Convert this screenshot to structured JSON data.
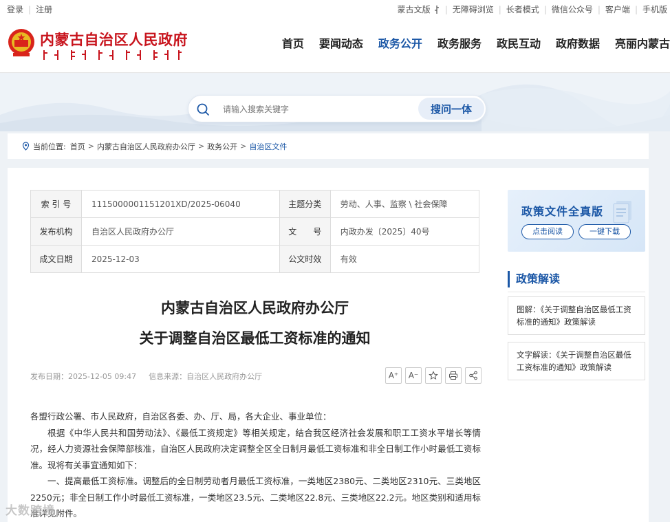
{
  "topbar": {
    "login": "登录",
    "register": "注册",
    "links": [
      "蒙古文版",
      "无障碍浏览",
      "长者模式",
      "微信公众号",
      "客户端",
      "手机版"
    ]
  },
  "header": {
    "site_title": "内蒙古自治区人民政府",
    "nav": [
      "首页",
      "要闻动态",
      "政务公开",
      "政务服务",
      "政民互动",
      "政府数据",
      "亮丽内蒙古"
    ],
    "active_nav": "政务公开"
  },
  "search": {
    "placeholder": "请输入搜索关键字",
    "button": "搜问一体"
  },
  "breadcrumb": {
    "label": "当前位置:",
    "items": [
      "首页",
      "内蒙古自治区人民政府办公厅",
      "政务公开",
      "自治区文件"
    ]
  },
  "meta": {
    "index_label": "索 引 号",
    "index_value": "1115000001151201XD/2025-06040",
    "topic_label": "主题分类",
    "topic_value": "劳动、人事、监察 \\ 社会保障",
    "issuer_label": "发布机构",
    "issuer_value": "自治区人民政府办公厅",
    "docno_label": "文　　号",
    "docno_value": "内政办发〔2025〕40号",
    "date_label": "成文日期",
    "date_value": "2025-12-03",
    "validity_label": "公文时效",
    "validity_value": "有效"
  },
  "article": {
    "title_line1": "内蒙古自治区人民政府办公厅",
    "title_line2": "关于调整自治区最低工资标准的通知",
    "publish_date": "发布日期：2025-12-05 09:47",
    "source": "信息来源：自治区人民政府办公厅",
    "tools": {
      "font_up": "A⁺",
      "font_down": "A⁻"
    },
    "para1": "各盟行政公署、市人民政府，自治区各委、办、厅、局，各大企业、事业单位：",
    "para2": "根据《中华人民共和国劳动法》、《最低工资规定》等相关规定，结合我区经济社会发展和职工工资水平增长等情况，经人力资源社会保障部核准，自治区人民政府决定调整全区全日制月最低工资标准和非全日制工作小时最低工资标准。现将有关事宜通知如下：",
    "para3": "一、提高最低工资标准。调整后的全日制劳动者月最低工资标准，一类地区2380元、二类地区2310元、三类地区2250元；非全日制工作小时最低工资标准，一类地区23.5元、二类地区22.8元、三类地区22.2元。地区类别和适用标准详见附件。"
  },
  "side": {
    "banner_title": "政策文件全真版",
    "read_button": "点击阅读",
    "download_button": "一键下载",
    "section_title": "政策解读",
    "card1": "图解：《关于调整自治区最低工资标准的通知》政策解读",
    "card2": "文字解读：《关于调整自治区最低工资标准的通知》政策解读"
  },
  "watermark": "大数跨境",
  "colors": {
    "brand_red": "#c8141d",
    "accent_blue": "#1b57a6"
  }
}
